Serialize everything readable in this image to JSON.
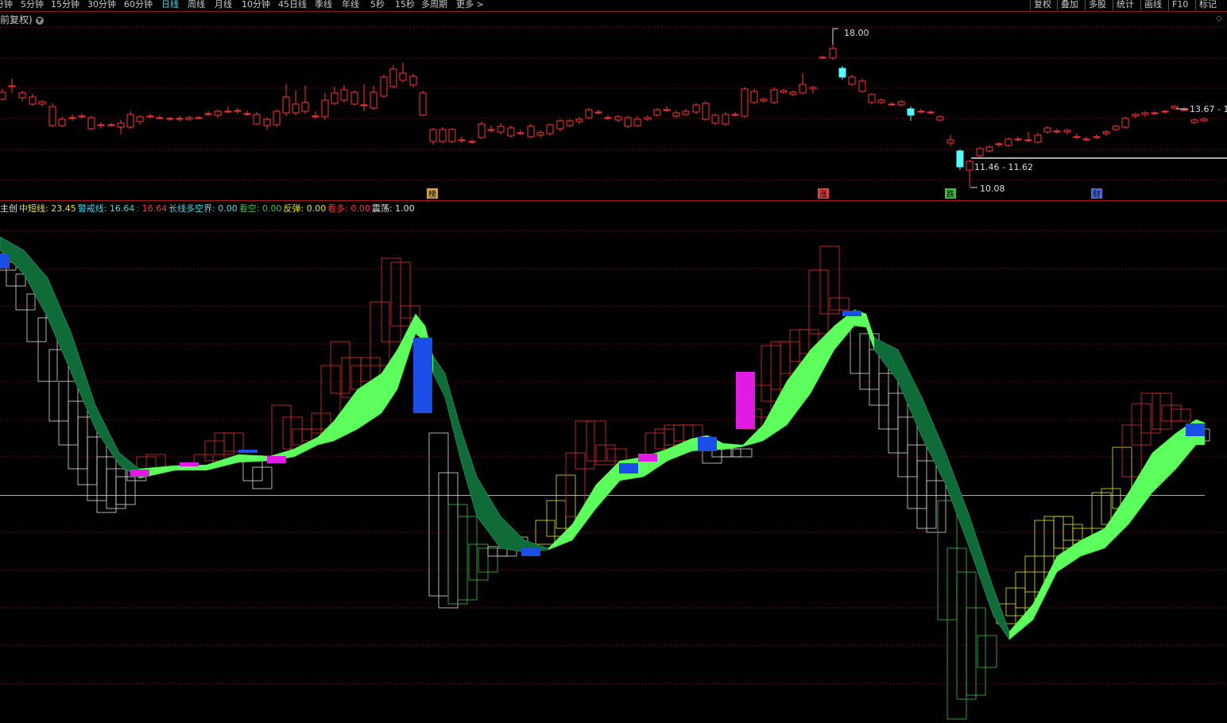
{
  "toolbar": {
    "periods": [
      "分钟",
      "5分钟",
      "15分钟",
      "30分钟",
      "60分钟",
      "日线",
      "周线",
      "月线",
      "10分钟",
      "45日线",
      "季线",
      "年线",
      "5秒",
      "15秒",
      "多周期",
      "更多 >"
    ],
    "active_period": "日线",
    "right_buttons": [
      "复权",
      "叠加",
      "多股",
      "统计",
      "画线",
      "F10",
      "标记"
    ]
  },
  "fq_label": "前复权)",
  "fq_icon": "chevron-down-icon",
  "settings_icon": "diamond-icon",
  "price_labels": {
    "high": "18.00",
    "range": "11.46 - 11.62",
    "low": "10.08",
    "right": "13.67 - 1"
  },
  "event_markers": [
    {
      "label": "榜",
      "color": "#d8a040"
    },
    {
      "label": "涨",
      "color": "#e04040"
    },
    {
      "label": "跌",
      "color": "#3cc03c"
    },
    {
      "label": "财",
      "color": "#4a6cd8"
    }
  ],
  "legend": [
    {
      "text": "主创",
      "color": "#e0e0e0"
    },
    {
      "text": "中短线: 23.45",
      "color": "#e6e628"
    },
    {
      "text": "警戒线: 16.64",
      "color": "#3ad9e6"
    },
    {
      "text": ": 16.64",
      "color": "#ff3030"
    },
    {
      "text": "长线多空界: 0.00",
      "color": "#3ad9e6"
    },
    {
      "text": "看空: 0.00",
      "color": "#3cc03c"
    },
    {
      "text": "反弹: 0.00",
      "color": "#e6e628"
    },
    {
      "text": "看多: 0.00",
      "color": "#ff3030"
    },
    {
      "text": "震荡: 1.00",
      "color": "#e0e0e0"
    }
  ],
  "colors": {
    "up": "#ff3333",
    "down": "#54fcfc",
    "grid": "#7a1010",
    "band_bear": "#0f6b38",
    "band_bull": "#5cff5c",
    "warning_line": "#3ad9e6"
  }
}
